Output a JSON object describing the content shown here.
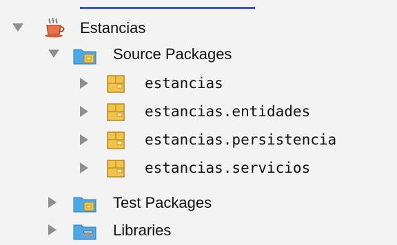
{
  "tree": {
    "root": {
      "label": "Estancias",
      "icon": "java-project-icon"
    },
    "source_packages": {
      "label": "Source Packages",
      "icon": "source-folder-icon"
    },
    "packages": [
      {
        "label": "estancias",
        "icon": "package-icon"
      },
      {
        "label": "estancias.entidades",
        "icon": "package-icon"
      },
      {
        "label": "estancias.persistencia",
        "icon": "package-icon"
      },
      {
        "label": "estancias.servicios",
        "icon": "package-icon"
      }
    ],
    "test_packages": {
      "label": "Test Packages",
      "icon": "test-folder-icon"
    },
    "libraries": {
      "label": "Libraries",
      "icon": "libraries-folder-icon"
    }
  },
  "colors": {
    "accent_line": "#2f56e6",
    "arrow": "#8f8f8f",
    "folder": "#4aa9e8",
    "package": "#f2c34a"
  }
}
